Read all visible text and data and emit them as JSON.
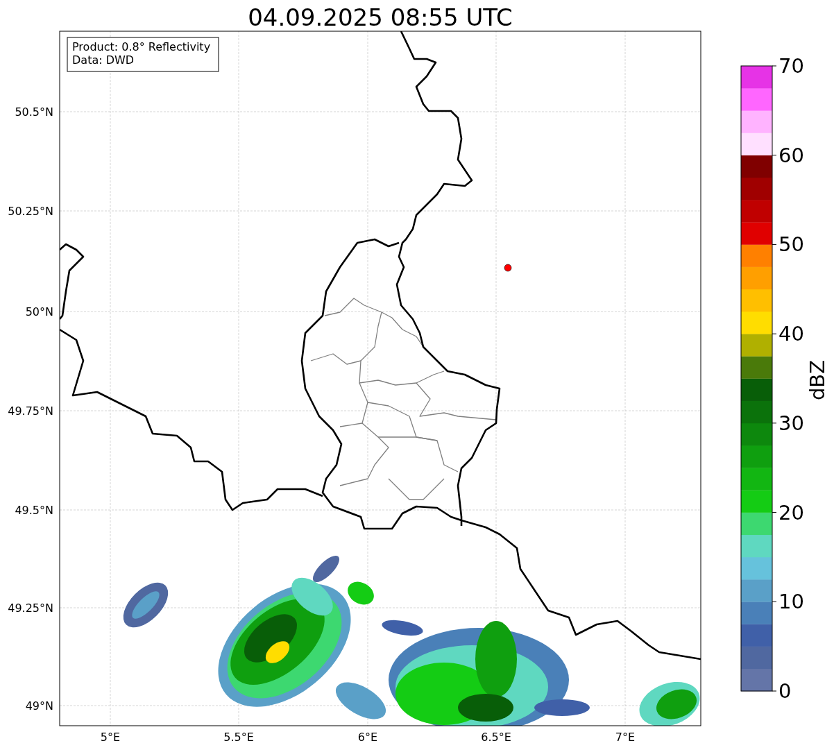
{
  "title": "04.09.2025 08:55 UTC",
  "info_box": [
    "Product: 0.8° Reflectivity",
    "Data: DWD"
  ],
  "lat_labels": [
    "50.5°N",
    "50.25°N",
    "50°N",
    "49.75°N",
    "49.5°N",
    "49.25°N",
    "49°N"
  ],
  "lon_labels": [
    "5°E",
    "5.5°E",
    "6°E",
    "6.5°E",
    "7°E"
  ],
  "colorbar": {
    "label": "dBZ",
    "ticks": [
      "70",
      "60",
      "50",
      "40",
      "30",
      "20",
      "10",
      "0"
    ],
    "bins": [
      {
        "color": "#6475a8"
      },
      {
        "color": "#5068a0"
      },
      {
        "color": "#4060a8"
      },
      {
        "color": "#4a80b8"
      },
      {
        "color": "#5aa0c8"
      },
      {
        "color": "#66c2dc"
      },
      {
        "color": "#5fd8c0"
      },
      {
        "color": "#3dd870"
      },
      {
        "color": "#14cc14"
      },
      {
        "color": "#12b612"
      },
      {
        "color": "#0f9f0f"
      },
      {
        "color": "#0d880d"
      },
      {
        "color": "#0b720b"
      },
      {
        "color": "#085e08"
      },
      {
        "color": "#4a7a0a"
      },
      {
        "color": "#b0b000"
      },
      {
        "color": "#ffdd00"
      },
      {
        "color": "#ffbf00"
      },
      {
        "color": "#ff9f00"
      },
      {
        "color": "#ff8000"
      },
      {
        "color": "#e00000"
      },
      {
        "color": "#c00000"
      },
      {
        "color": "#a00000"
      },
      {
        "color": "#800000"
      },
      {
        "color": "#ffe0ff"
      },
      {
        "color": "#ffb3ff"
      },
      {
        "color": "#ff66ff"
      },
      {
        "color": "#e633e6"
      }
    ]
  }
}
